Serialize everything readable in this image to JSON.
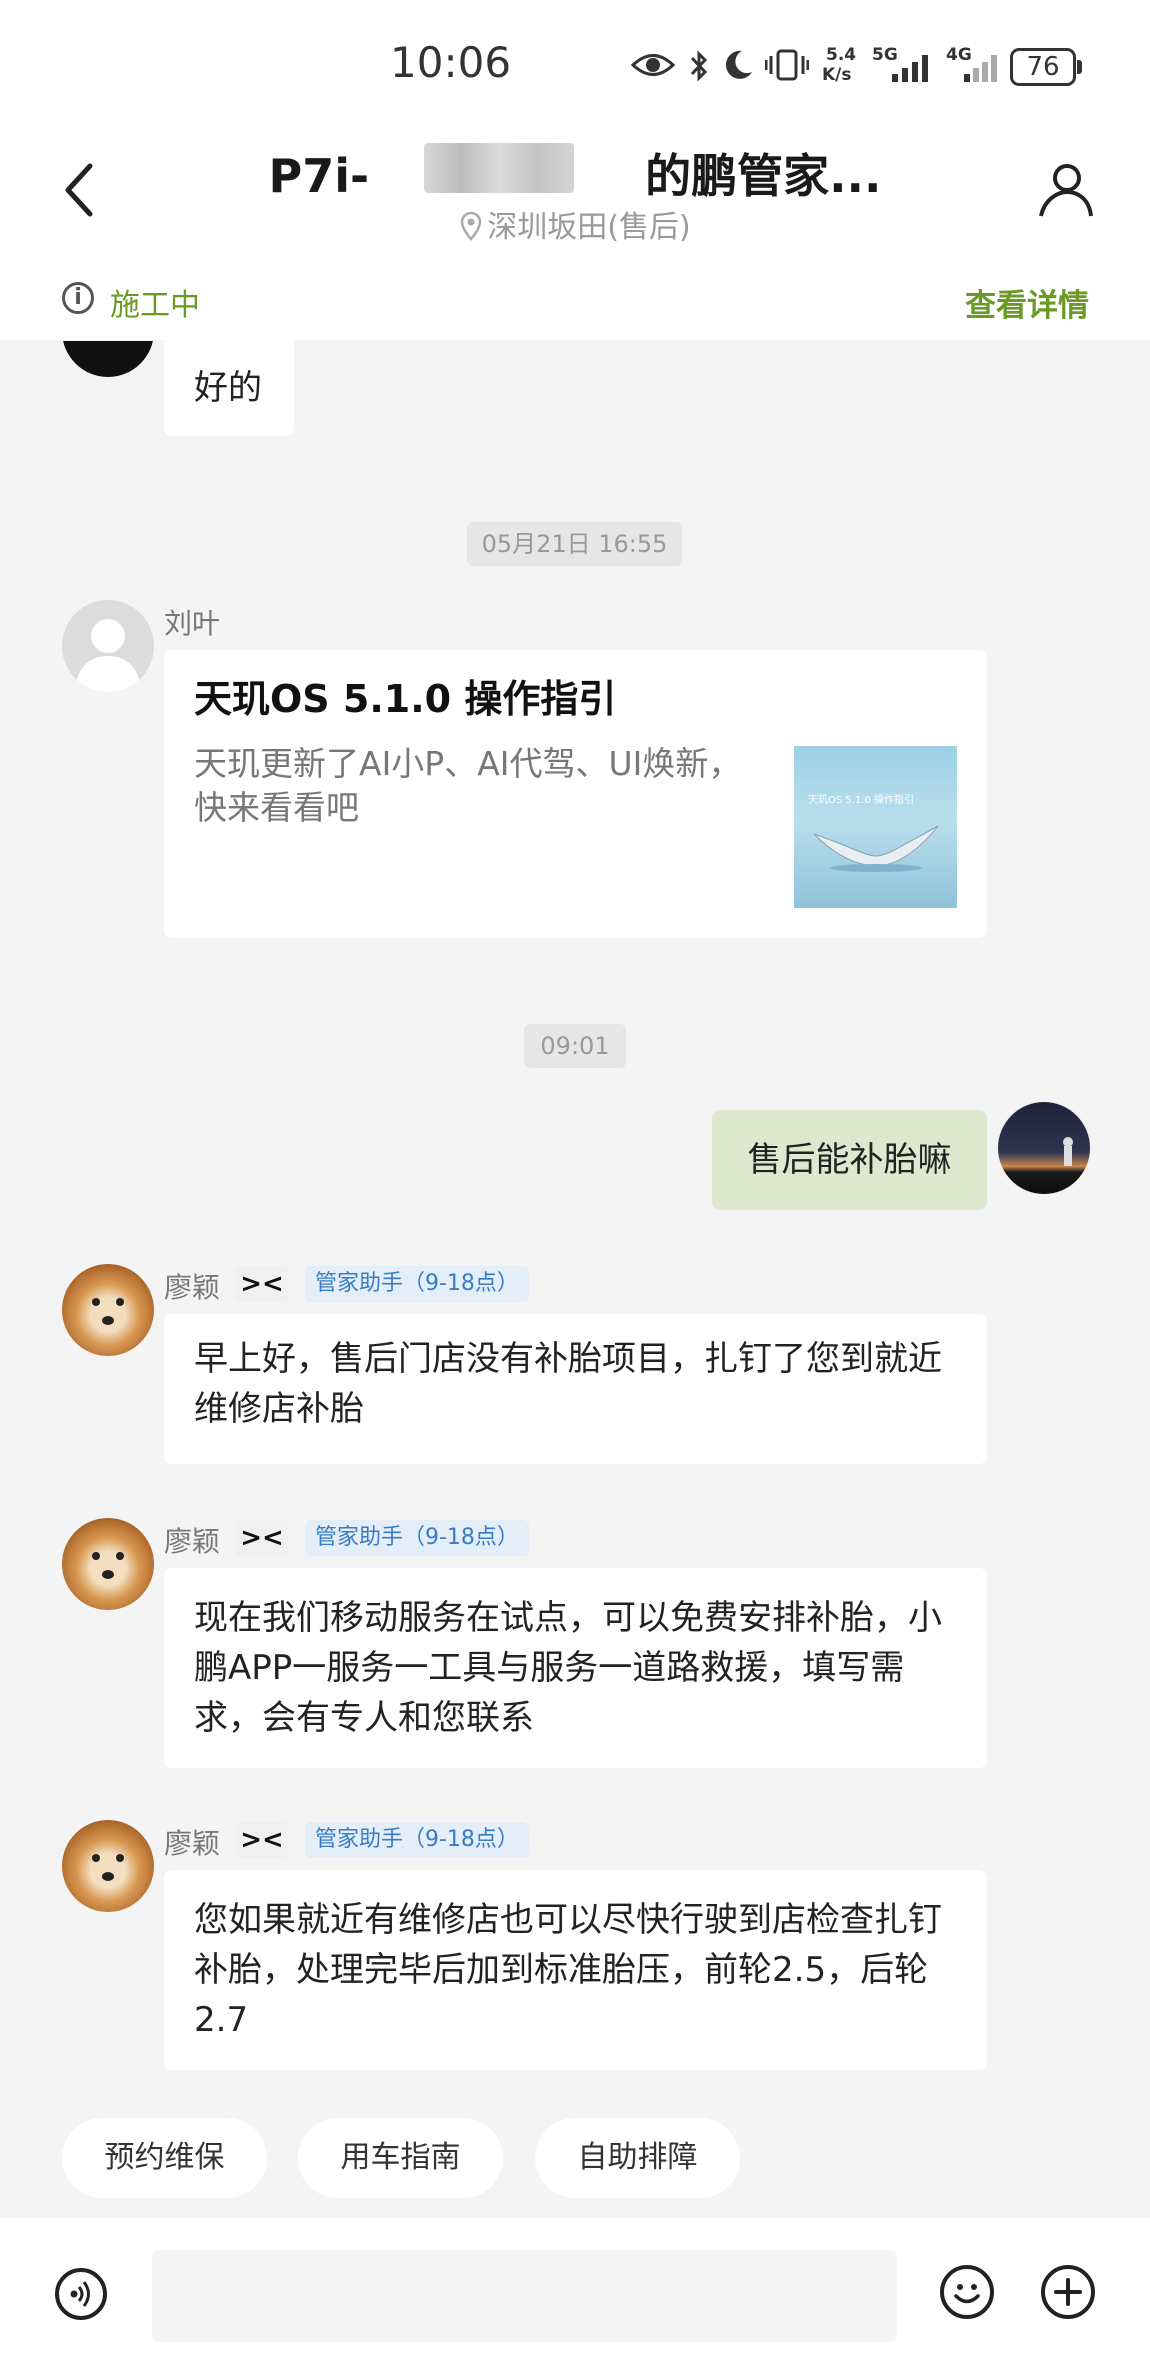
{
  "status_bar": {
    "time": "10:06",
    "net_speed_value": "5.4",
    "net_speed_unit": "K/s",
    "signal1_label": "5G",
    "signal2_label": "4G",
    "battery": "76"
  },
  "header": {
    "title": "P7i-　　　　　　的鹏管家...",
    "location": "深圳坂田(售后)"
  },
  "status_row": {
    "status": "施工中",
    "details_link": "查看详情"
  },
  "messages": {
    "m0": {
      "text": "好的"
    },
    "t1": "05月21日 16:55",
    "m1": {
      "sender": "刘叶",
      "card_title": "天玑OS 5.1.0 操作指引",
      "card_desc": "天玑更新了AI小P、AI代驾、UI焕新，快来看看吧",
      "thumb_text": "天玑OS 5.1.0 操作指引"
    },
    "t2": "09:01",
    "m2": {
      "text": "售后能补胎嘛"
    },
    "m3": {
      "sender": "廖颖",
      "tag": "管家助手（9-18点）",
      "text": "早上好，售后门店没有补胎项目，扎钉了您到就近维修店补胎"
    },
    "m4": {
      "sender": "廖颖",
      "tag": "管家助手（9-18点）",
      "text": "现在我们移动服务在试点，可以免费安排补胎，小鹏APP一服务一工具与服务一道路救援，填写需求，会有专人和您联系"
    },
    "m5": {
      "sender": "廖颖",
      "tag": "管家助手（9-18点）",
      "text": "您如果就近有维修店也可以尽快行驶到店检查扎钉补胎，处理完毕后加到标准胎压，前轮2.5，后轮2.7"
    }
  },
  "quick_replies": [
    "预约维保",
    "用车指南",
    "自助排障"
  ],
  "icons": {
    "back": "chevron-left-icon",
    "profile": "person-icon",
    "location": "map-pin-icon",
    "info": "info-icon",
    "voice": "voice-icon",
    "emoji": "emoji-icon",
    "plus": "plus-icon"
  },
  "colors": {
    "accent_green": "#6b9a24",
    "outgoing_bubble": "#dde8cf",
    "role_tag_bg": "#e3eef9",
    "role_tag_text": "#3a7cc4"
  }
}
